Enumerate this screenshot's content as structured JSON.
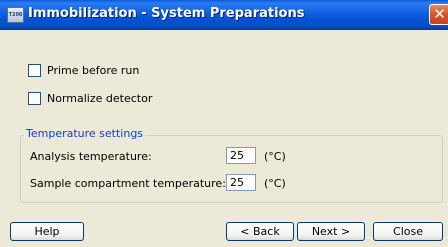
{
  "window": {
    "title": "Immobilization - System Preparations",
    "icon_text": "T200"
  },
  "options": [
    {
      "label": "Prime before run",
      "checked": false
    },
    {
      "label": "Normalize detector",
      "checked": false
    }
  ],
  "temperature": {
    "group_title": "Temperature settings",
    "fields": [
      {
        "label": "Analysis temperature:",
        "value": "25",
        "unit": "(°C)"
      },
      {
        "label": "Sample compartment temperature:",
        "value": "25",
        "unit": "(°C)"
      }
    ]
  },
  "buttons": {
    "help": "Help",
    "back": "< Back",
    "next": "Next >",
    "close": "Close"
  },
  "colors": {
    "titlebar": "#0a5bd8",
    "window_bg": "#ece9d8",
    "group_title": "#0046d5",
    "close_button": "#d9572f"
  }
}
